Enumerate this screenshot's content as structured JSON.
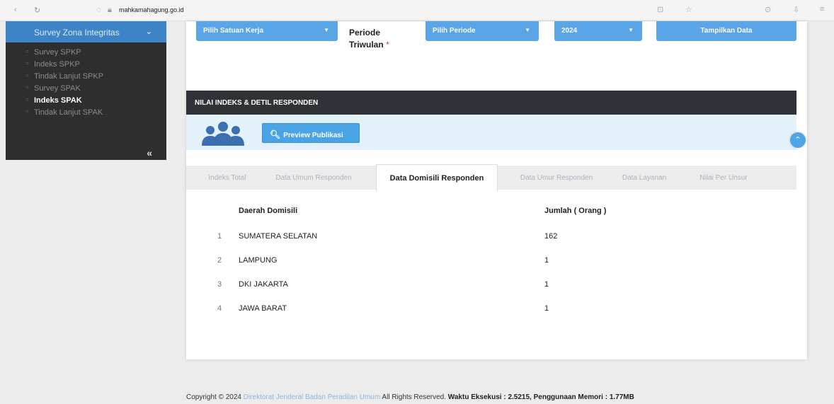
{
  "browser": {
    "url_host": "mahkamahagung.go.id",
    "nav_back": "‹",
    "nav_reload": "↻"
  },
  "sidebar": {
    "section_title": "Survey Zona Integritas",
    "items": [
      {
        "label": "Survey SPKP",
        "active": false
      },
      {
        "label": "Indeks SPKP",
        "active": false
      },
      {
        "label": "Tindak Lanjut SPKP",
        "active": false
      },
      {
        "label": "Survey SPAK",
        "active": false
      },
      {
        "label": "Indeks SPAK",
        "active": true
      },
      {
        "label": "Tindak Lanjut SPAK",
        "active": false
      }
    ],
    "collapse_glyph": "«"
  },
  "filters": {
    "satuan_kerja": "Pilih Satuan Kerja",
    "periode_label_line1": "Periode",
    "periode_label_line2": "Triwulan",
    "periode_required": "*",
    "periode_select": "Pilih Periode",
    "year_select": "2024",
    "show_button": "Tampilkan Data"
  },
  "section": {
    "title": "NILAI INDEKS & DETIL RESPONDEN",
    "preview_button": "Preview Publikasi"
  },
  "tabs": [
    {
      "label": "Indeks Total",
      "active": false
    },
    {
      "label": "Data Umum Responden",
      "active": false
    },
    {
      "label": "Data Domisili Responden",
      "active": true
    },
    {
      "label": "Data Umur Responden",
      "active": false
    },
    {
      "label": "Data Layanan",
      "active": false
    },
    {
      "label": "Nilai Per Unsur",
      "active": false
    }
  ],
  "table": {
    "headers": {
      "region": "Daerah Domisili",
      "count": "Jumlah ( Orang )"
    },
    "rows": [
      {
        "no": "1",
        "region": "SUMATERA SELATAN",
        "count": "162"
      },
      {
        "no": "2",
        "region": "LAMPUNG",
        "count": "1"
      },
      {
        "no": "3",
        "region": "DKI JAKARTA",
        "count": "1"
      },
      {
        "no": "4",
        "region": "JAWA BARAT",
        "count": "1"
      }
    ]
  },
  "footer": {
    "copyright": "Copyright © 2024",
    "org": "Direktorat Jenderal Badan Peradilan Umum",
    "rights": "All Rights Reserved.",
    "exec_label": "Waktu Eksekusi : 2.5215,",
    "mem_label": "Penggunaan Memori : 1.77MB"
  },
  "colors": {
    "accent": "#5aa4e8",
    "sidebar_bg": "#2e2e2e",
    "section_bar": "#2f3236"
  }
}
